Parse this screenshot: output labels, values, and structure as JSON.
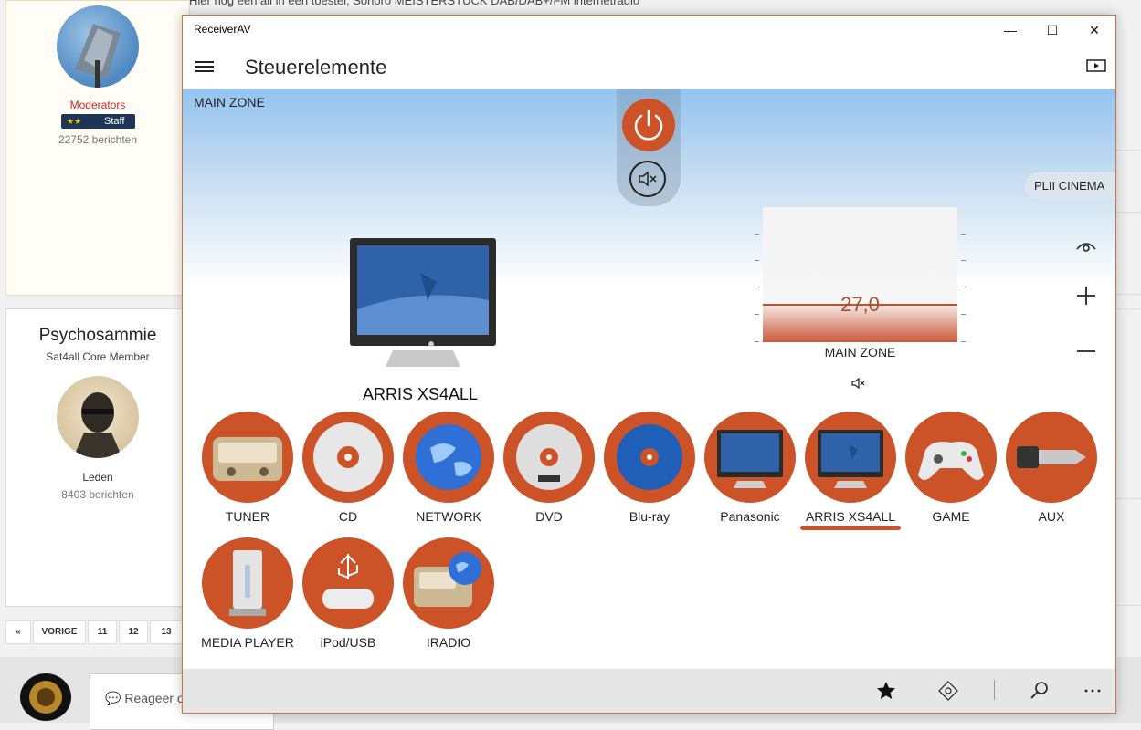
{
  "background_page": {
    "top_text": "Hier nog een all in een toestel, Sonoro MEISTERSTUCK DAB/DAB+/FM internetradio",
    "post1": {
      "role": "Moderators",
      "badge": "Staff",
      "posts": "22752 berichten"
    },
    "post2": {
      "username": "Psychosammie",
      "rank": "Sat4all Core Member",
      "group": "Leden",
      "posts": "8403 berichten"
    },
    "pagination": {
      "prev_icon": "double-chevron-left-icon",
      "prev_label": "VORIGE",
      "pages": [
        "11",
        "12",
        "13"
      ]
    },
    "reply_placeholder": "Reageer o"
  },
  "window": {
    "title": "ReceiverAV",
    "controls": {
      "minimize": "—",
      "maximize": "☐",
      "close": "✕"
    },
    "app_title": "Steuerelemente",
    "zone_label": "MAIN ZONE",
    "surround_mode": "PLII CINEMA",
    "current_device": "ARRIS XS4ALL",
    "volume": {
      "value": "27,0",
      "zone": "MAIN ZONE",
      "level_fraction": 0.27
    },
    "sources": [
      {
        "label": "TUNER",
        "icon": "radio-icon"
      },
      {
        "label": "CD",
        "icon": "cd-icon"
      },
      {
        "label": "NETWORK",
        "icon": "globe-icon"
      },
      {
        "label": "DVD",
        "icon": "dvd-icon"
      },
      {
        "label": "Blu-ray",
        "icon": "bluray-icon"
      },
      {
        "label": "Panasonic",
        "icon": "tv-icon"
      },
      {
        "label": "ARRIS XS4ALL",
        "icon": "tv-icon",
        "selected": true
      },
      {
        "label": "GAME",
        "icon": "gamepad-icon"
      },
      {
        "label": "AUX",
        "icon": "audio-jack-icon"
      },
      {
        "label": "MEDIA PLAYER",
        "icon": "media-player-icon"
      },
      {
        "label": "iPod/USB",
        "icon": "usb-icon"
      },
      {
        "label": "IRADIO",
        "icon": "internet-radio-icon"
      }
    ],
    "colors": {
      "accent": "#cc5228",
      "hero_top": "#94c3ef",
      "command_bar": "#e6e6e6"
    }
  }
}
